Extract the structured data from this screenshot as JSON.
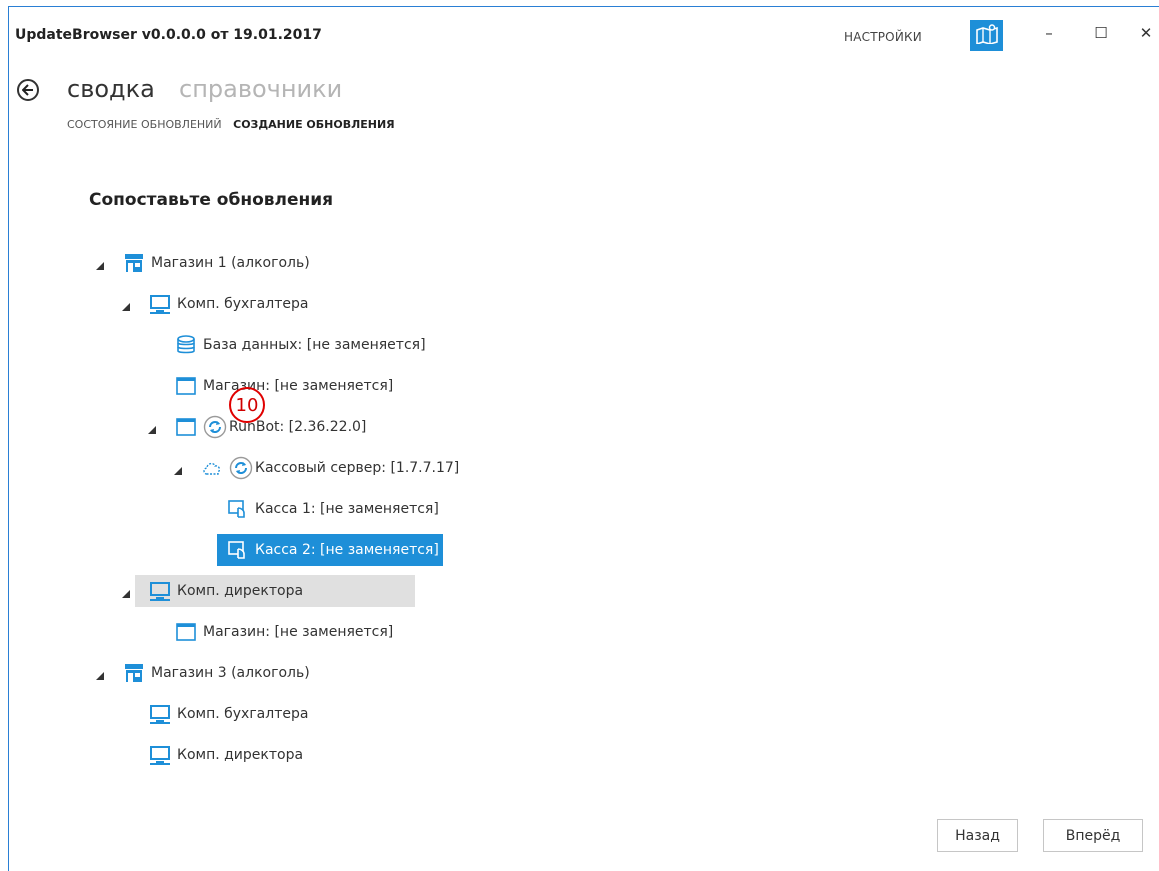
{
  "window": {
    "title": "UpdateBrowser v0.0.0.0 от 19.01.2017",
    "settings_label": "НАСТРОЙКИ",
    "minimize_glyph": "–",
    "maximize_glyph": "☐",
    "close_glyph": "✕"
  },
  "nav": {
    "current": "сводка",
    "other": "справочники"
  },
  "subtabs": [
    {
      "label": "СОСТОЯНИЕ ОБНОВЛЕНИЙ",
      "active": false
    },
    {
      "label": "СОЗДАНИЕ ОБНОВЛЕНИЯ",
      "active": true
    }
  ],
  "heading": "Сопоставьте обновления",
  "tree": [
    {
      "label": "Магазин 1 (алкоголь)",
      "icon": "store-icon",
      "level": 0,
      "expanded": true
    },
    {
      "label": "Комп. бухгалтера",
      "icon": "computer-icon",
      "level": 1,
      "expanded": true
    },
    {
      "label": "База данных: [не заменяется]",
      "icon": "database-icon",
      "level": 2
    },
    {
      "label": "Магазин: [не заменяется]",
      "icon": "window-icon",
      "level": 2
    },
    {
      "label": "RunBot: [2.36.22.0]",
      "icon": "window-icon",
      "level": 2,
      "expanded": true,
      "update_icon": true
    },
    {
      "label": "Кассовый сервер: [1.7.7.17]",
      "icon": "cloud-server-icon",
      "level": 3,
      "expanded": true,
      "update_icon": true
    },
    {
      "label": "Касса 1: [не заменяется]",
      "icon": "cash-register-icon",
      "level": 4
    },
    {
      "label": "Касса 2: [не заменяется]",
      "icon": "cash-register-icon",
      "level": 4,
      "selected": true
    },
    {
      "label": "Комп. директора",
      "icon": "computer-icon",
      "level": 1,
      "expanded": true,
      "hovered": true
    },
    {
      "label": "Магазин: [не заменяется]",
      "icon": "window-icon",
      "level": 2
    },
    {
      "label": "Магазин 3 (алкоголь)",
      "icon": "store-icon",
      "level": 0,
      "expanded": true
    },
    {
      "label": "Комп. бухгалтера",
      "icon": "computer-icon",
      "level": 1
    },
    {
      "label": "Комп. директора",
      "icon": "computer-icon",
      "level": 1
    }
  ],
  "badge": "10",
  "buttons": {
    "back": "Назад",
    "next": "Вперёд"
  },
  "colors": {
    "accent": "#1e8fd8",
    "selection": "#1e8fd8",
    "hover": "#e0e0e0",
    "annotation": "#e00000"
  }
}
